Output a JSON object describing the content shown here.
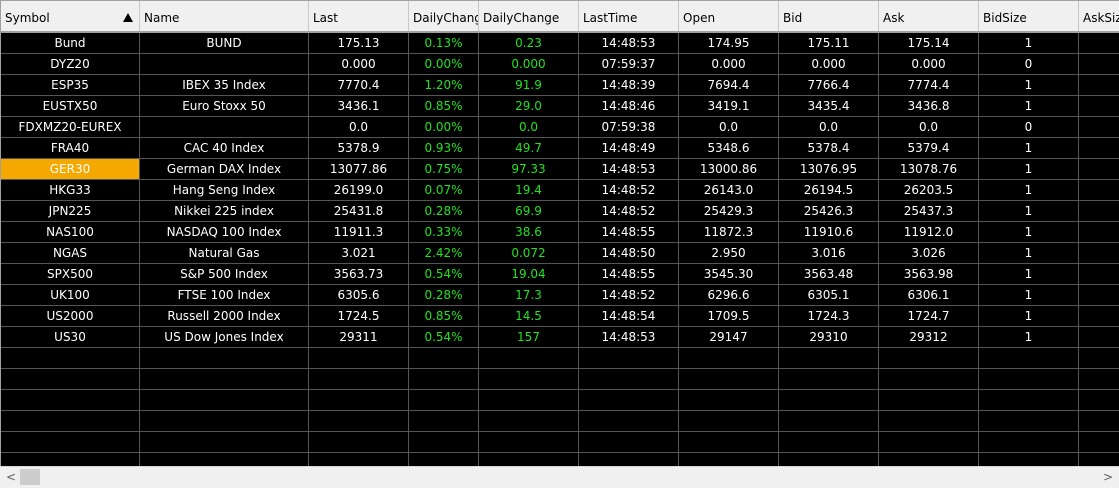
{
  "columns": [
    {
      "label": "Symbol"
    },
    {
      "label": "Name"
    },
    {
      "label": "Last"
    },
    {
      "label": "DailyChang"
    },
    {
      "label": "DailyChange"
    },
    {
      "label": "LastTime"
    },
    {
      "label": "Open"
    },
    {
      "label": "Bid"
    },
    {
      "label": "Ask"
    },
    {
      "label": "BidSize"
    },
    {
      "label": "AskSiz"
    }
  ],
  "sort": {
    "column": "Symbol",
    "direction": "ascending"
  },
  "selected_symbol": "GER30",
  "colors": {
    "positive": "#22e022",
    "selected": "#f5a800",
    "background": "#000000",
    "text": "#ffffff"
  },
  "rows": [
    [
      "Bund",
      "BUND",
      "175.13",
      "0.13%",
      "0.23",
      "14:48:53",
      "174.95",
      "175.11",
      "175.14",
      "1",
      ""
    ],
    [
      "DYZ20",
      "",
      "0.000",
      "0.00%",
      "0.000",
      "07:59:37",
      "0.000",
      "0.000",
      "0.000",
      "0",
      ""
    ],
    [
      "ESP35",
      "IBEX 35 Index",
      "7770.4",
      "1.20%",
      "91.9",
      "14:48:39",
      "7694.4",
      "7766.4",
      "7774.4",
      "1",
      ""
    ],
    [
      "EUSTX50",
      "Euro Stoxx 50",
      "3436.1",
      "0.85%",
      "29.0",
      "14:48:46",
      "3419.1",
      "3435.4",
      "3436.8",
      "1",
      ""
    ],
    [
      "FDXMZ20-EUREX",
      "",
      "0.0",
      "0.00%",
      "0.0",
      "07:59:38",
      "0.0",
      "0.0",
      "0.0",
      "0",
      ""
    ],
    [
      "FRA40",
      "CAC 40 Index",
      "5378.9",
      "0.93%",
      "49.7",
      "14:48:49",
      "5348.6",
      "5378.4",
      "5379.4",
      "1",
      ""
    ],
    [
      "GER30",
      "German DAX Index",
      "13077.86",
      "0.75%",
      "97.33",
      "14:48:53",
      "13000.86",
      "13076.95",
      "13078.76",
      "1",
      ""
    ],
    [
      "HKG33",
      "Hang Seng Index",
      "26199.0",
      "0.07%",
      "19.4",
      "14:48:52",
      "26143.0",
      "26194.5",
      "26203.5",
      "1",
      ""
    ],
    [
      "JPN225",
      "Nikkei 225 index",
      "25431.8",
      "0.28%",
      "69.9",
      "14:48:52",
      "25429.3",
      "25426.3",
      "25437.3",
      "1",
      ""
    ],
    [
      "NAS100",
      "NASDAQ 100 Index",
      "11911.3",
      "0.33%",
      "38.6",
      "14:48:55",
      "11872.3",
      "11910.6",
      "11912.0",
      "1",
      ""
    ],
    [
      "NGAS",
      "Natural Gas",
      "3.021",
      "2.42%",
      "0.072",
      "14:48:50",
      "2.950",
      "3.016",
      "3.026",
      "1",
      ""
    ],
    [
      "SPX500",
      "S&P 500 Index",
      "3563.73",
      "0.54%",
      "19.04",
      "14:48:55",
      "3545.30",
      "3563.48",
      "3563.98",
      "1",
      ""
    ],
    [
      "UK100",
      "FTSE 100 Index",
      "6305.6",
      "0.28%",
      "17.3",
      "14:48:52",
      "6296.6",
      "6305.1",
      "6306.1",
      "1",
      ""
    ],
    [
      "US2000",
      "Russell 2000 Index",
      "1724.5",
      "0.85%",
      "14.5",
      "14:48:54",
      "1709.5",
      "1724.3",
      "1724.7",
      "1",
      ""
    ],
    [
      "US30",
      "US Dow Jones Index",
      "29311",
      "0.54%",
      "157",
      "14:48:53",
      "29147",
      "29310",
      "29312",
      "1",
      ""
    ]
  ],
  "empty_rows": 6,
  "scrollbar": {
    "left_arrow": "<",
    "right_arrow": ">"
  }
}
